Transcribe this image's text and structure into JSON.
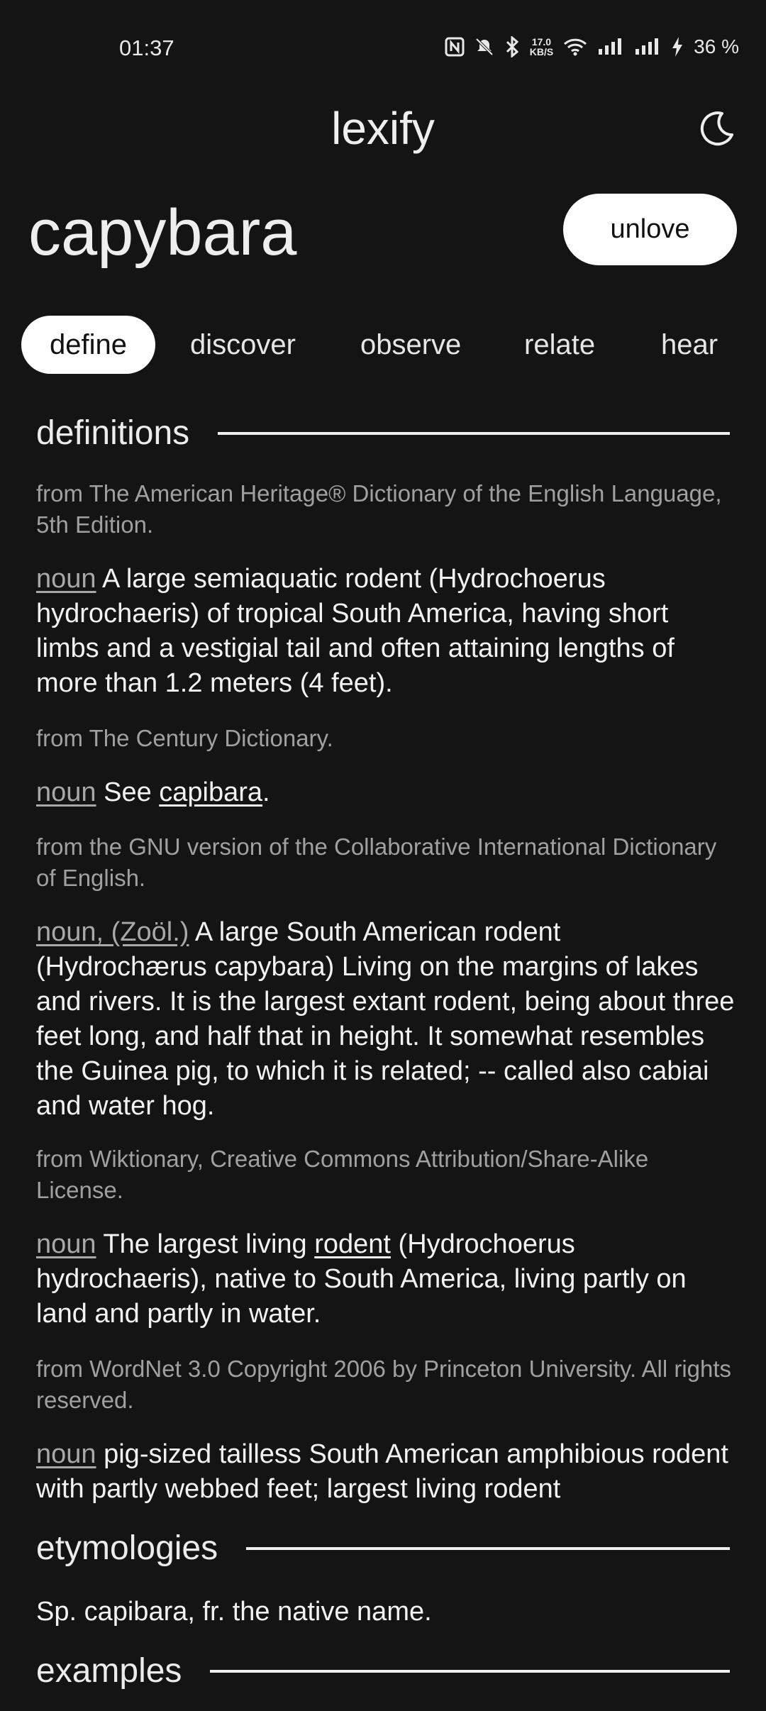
{
  "status_bar": {
    "time": "01:37",
    "net_speed": "17.0",
    "net_unit": "KB/S",
    "battery": "36 %"
  },
  "app": {
    "title": "lexify"
  },
  "word": {
    "title": "capybara",
    "unlove_label": "unlove"
  },
  "tabs": [
    {
      "label": "define",
      "active": true
    },
    {
      "label": "discover",
      "active": false
    },
    {
      "label": "observe",
      "active": false
    },
    {
      "label": "relate",
      "active": false
    },
    {
      "label": "hear",
      "active": false
    }
  ],
  "sections": {
    "definitions": "definitions",
    "etymologies": "etymologies",
    "examples": "examples"
  },
  "definitions": [
    {
      "source": "from The American Heritage® Dictionary of the English Language, 5th Edition.",
      "pos": "noun",
      "text": " A large semiaquatic rodent (Hydrochoerus hydrochaeris) of tropical South America, having short limbs and a vestigial tail and often attaining lengths of more than 1.2 meters (4 feet)."
    },
    {
      "source": "from The Century Dictionary.",
      "pos": "noun",
      "text_before": " See ",
      "link": "capibara",
      "text_after": "."
    },
    {
      "source": "from the GNU version of the Collaborative International Dictionary of English.",
      "pos": "noun, (Zoöl.)",
      "text": " A large South American rodent (Hydrochærus capybara) Living on the margins of lakes and rivers. It is the largest extant rodent, being about three feet long, and half that in height. It somewhat resembles the Guinea pig, to which it is related; -- called also cabiai and water hog."
    },
    {
      "source": "from Wiktionary, Creative Commons Attribution/Share-Alike License.",
      "pos": "noun",
      "text_before": " The largest living ",
      "link": "rodent",
      "text_after": " (Hydrochoerus hydrochaeris), native to South America, living partly on land and partly in water."
    },
    {
      "source": "from WordNet 3.0 Copyright 2006 by Princeton University. All rights reserved.",
      "pos": "noun",
      "text": " pig-sized tailless South American amphibious rodent with partly webbed feet; largest living rodent"
    }
  ],
  "etymology": "Sp. capibara, fr. the native name.",
  "icons": [
    "moon-icon",
    "nfc-icon",
    "mute-icon",
    "bluetooth-icon",
    "wifi-icon",
    "signal-icon",
    "battery-charging-icon"
  ]
}
